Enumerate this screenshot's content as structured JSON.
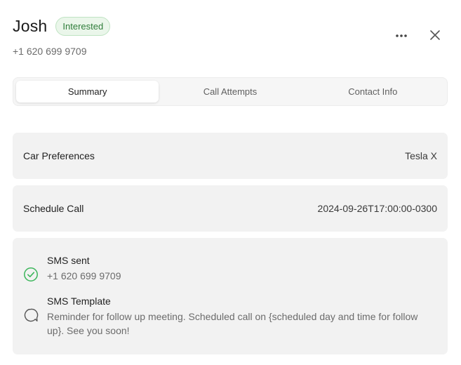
{
  "contact": {
    "name": "Josh",
    "status": "Interested",
    "phone": "+1 620 699 9709"
  },
  "header_actions": {
    "more_icon": "ellipsis-icon",
    "close_icon": "close-icon"
  },
  "tabs": [
    {
      "label": "Summary",
      "active": true
    },
    {
      "label": "Call Attempts",
      "active": false
    },
    {
      "label": "Contact Info",
      "active": false
    }
  ],
  "fields": [
    {
      "label": "Car Preferences",
      "value": "Tesla X"
    },
    {
      "label": "Schedule Call",
      "value": "2024-09-26T17:00:00-0300"
    }
  ],
  "sms": [
    {
      "title": "SMS sent",
      "detail": "+1 620 699 9709",
      "icon": "check-circle-icon",
      "status_color": "#3bb55a"
    },
    {
      "title": "SMS Template",
      "detail": "Reminder for follow up meeting. Scheduled call on {scheduled day and time for follow up}. See you soon!",
      "icon": "message-bubble-icon"
    }
  ],
  "colors": {
    "badge_text": "#2f7d3a",
    "badge_bg": "#eaf6ea",
    "card_bg": "#f2f2f2",
    "success": "#3bb55a"
  }
}
